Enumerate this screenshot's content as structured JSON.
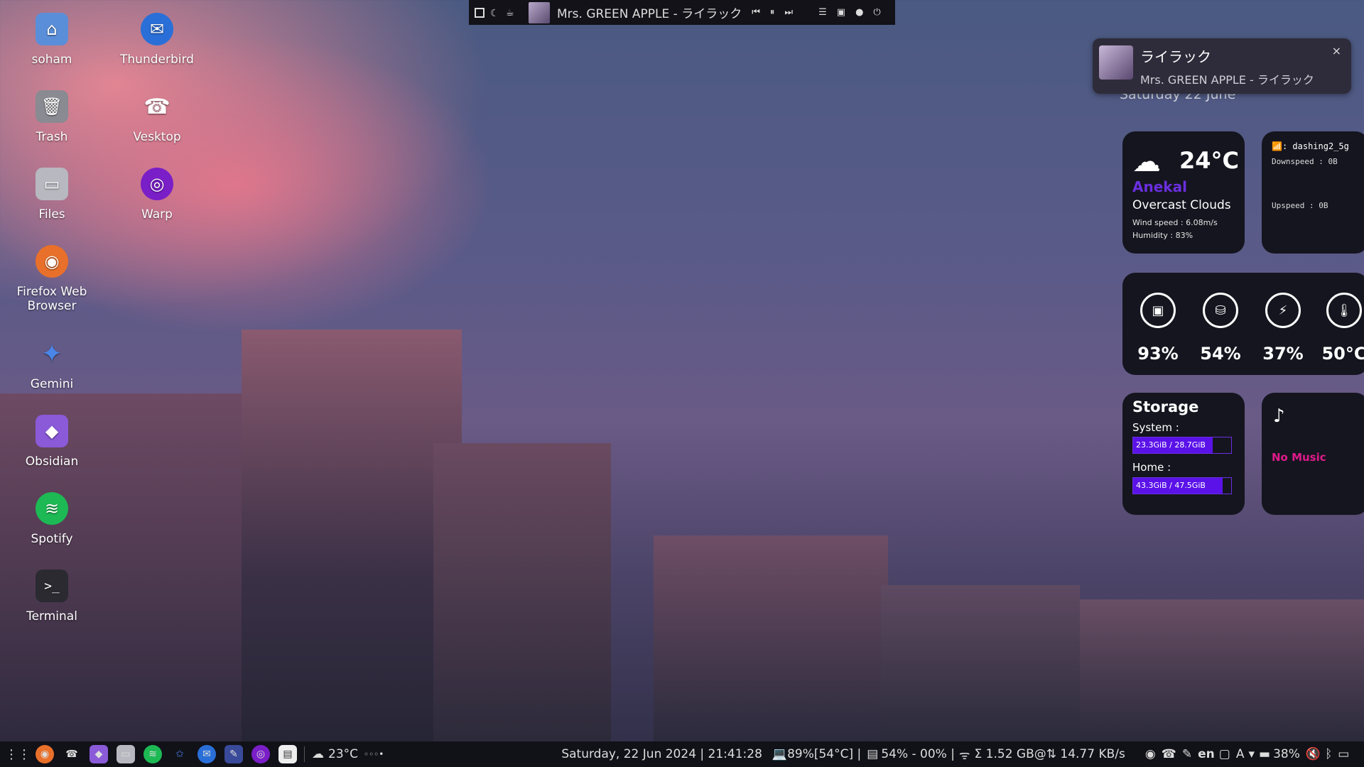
{
  "topbar": {
    "track_title": "Mrs. GREEN APPLE - ライラック",
    "icons": [
      "workspace-icon",
      "moon-icon",
      "cup-icon"
    ],
    "controls": {
      "prev": "⏮",
      "pause": "⏸",
      "next": "⏭",
      "menu": "☰",
      "screen": "▣",
      "record": "●",
      "power": "⏻"
    }
  },
  "desktop": {
    "icons": [
      {
        "label": "soham",
        "icon": "home-folder-icon"
      },
      {
        "label": "Thunderbird",
        "icon": "thunderbird-icon"
      },
      {
        "label": "Trash",
        "icon": "trash-icon"
      },
      {
        "label": "Vesktop",
        "icon": "vesktop-icon"
      },
      {
        "label": "Files",
        "icon": "files-icon"
      },
      {
        "label": "Warp",
        "icon": "warp-icon"
      },
      {
        "label": "Firefox Web Browser",
        "icon": "firefox-icon"
      },
      {
        "label": "Gemini",
        "icon": "gemini-icon"
      },
      {
        "label": "Obsidian",
        "icon": "obsidian-icon"
      },
      {
        "label": "Spotify",
        "icon": "spotify-icon"
      },
      {
        "label": "Terminal",
        "icon": "terminal-icon"
      }
    ]
  },
  "notification": {
    "title": "ライラック",
    "body": "Mrs. GREEN APPLE - ライラック",
    "close": "×",
    "date_behind": "Saturday 22 June"
  },
  "weather": {
    "temp": "24°C",
    "location": "Anekal",
    "condition": "Overcast Clouds",
    "wind": "Wind speed : 6.08m/s",
    "humidity": "Humidity : 83%"
  },
  "network": {
    "ssid": "dashing2_5g",
    "down": "Downspeed : 0B",
    "up": "Upspeed : 0B"
  },
  "stats": {
    "cpu": "93%",
    "ram": "54%",
    "battery": "37%",
    "temp": "50°C"
  },
  "storage": {
    "title": "Storage",
    "system_label": "System :",
    "system_value": "23.3GiB / 28.7GiB",
    "system_fraction": 0.81,
    "home_label": "Home :",
    "home_value": "43.3GiB / 47.5GiB",
    "home_fraction": 0.91
  },
  "music": {
    "status": "No Music"
  },
  "taskbar": {
    "weather": "23°C",
    "weather_dots": "◦◦◦•",
    "datetime": "Saturday, 22 Jun 2024 | 21:41:28",
    "cpu": "💻89%[54°C] |",
    "ram": "54% - 00% |",
    "net": "Σ 1.52 GB@⇅ 14.77 KB/s",
    "lang": "en",
    "battery": "38%"
  },
  "colors": {
    "accent": "#6a2fe0",
    "bar_fill": "#5a12e8",
    "music_status": "#e01a8a",
    "card_bg": "#15151f"
  }
}
